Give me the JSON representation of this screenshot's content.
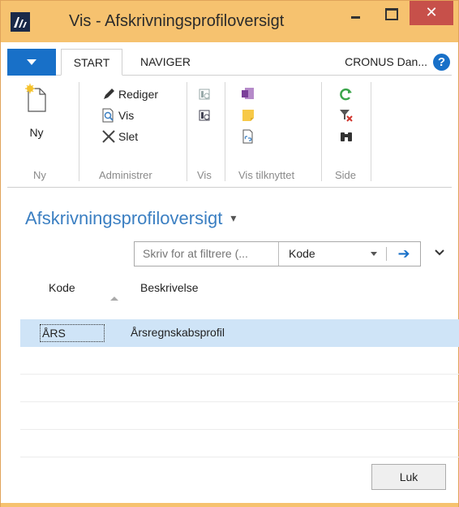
{
  "window": {
    "title": "Vis - Afskrivningsprofiloversigt",
    "close_glyph": "✕"
  },
  "ribbon_tabs": {
    "start": "START",
    "naviger": "NAVIGER",
    "company": "CRONUS Dan...",
    "help_glyph": "?"
  },
  "ribbon": {
    "ny": {
      "button": "Ny",
      "group": "Ny"
    },
    "administrer": {
      "rediger": "Rediger",
      "vis": "Vis",
      "slet": "Slet",
      "group": "Administrer"
    },
    "vis_group": {
      "group": "Vis"
    },
    "vis_tilknyttet": {
      "group": "Vis tilknyttet"
    },
    "side": {
      "group": "Side"
    }
  },
  "page": {
    "title": "Afskrivningsprofiloversigt",
    "title_caret": "▾"
  },
  "filter": {
    "placeholder": "Skriv for at filtrere (...",
    "field": "Kode",
    "go_glyph": "➔"
  },
  "columns": {
    "code": "Kode",
    "description": "Beskrivelse"
  },
  "rows": [
    {
      "code": "ÅRS",
      "description": "Årsregnskabsprofil",
      "selected": true
    }
  ],
  "footer": {
    "close_label": "Luk"
  },
  "colors": {
    "titlebar": "#f6c26f",
    "accent": "#1870c8",
    "page_title": "#3b7fc2",
    "selection": "#cfe4f7",
    "close_button": "#c7504a"
  }
}
